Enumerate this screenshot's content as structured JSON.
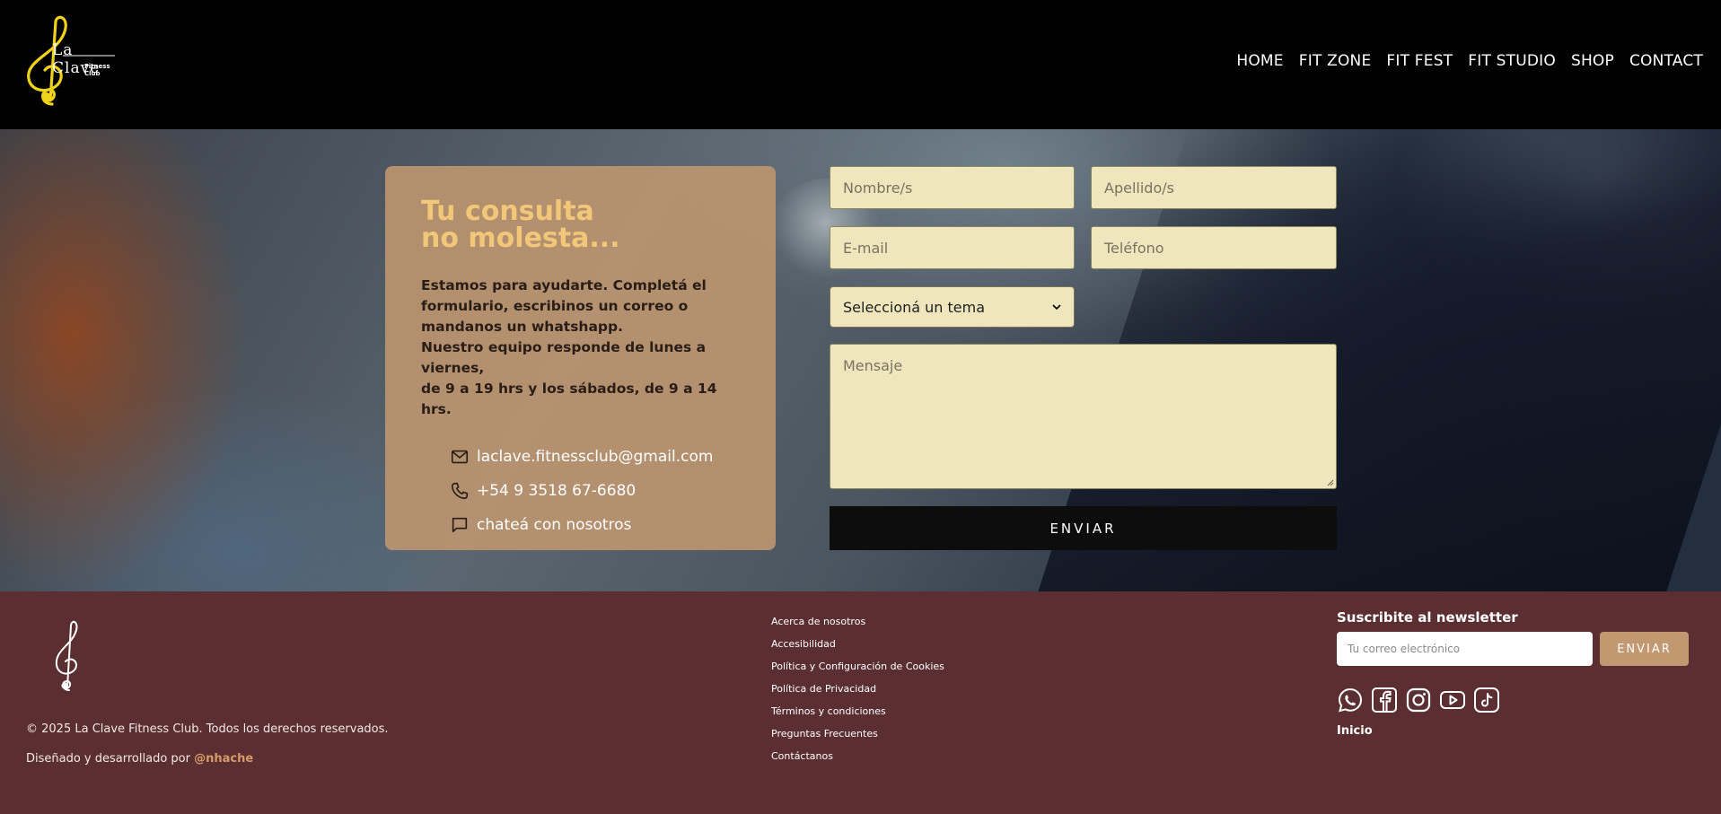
{
  "header": {
    "logo": {
      "main_text": "La Clave",
      "sub_text": "Fitness Club",
      "icon": "treble-clef-icon",
      "color": "#f0d319"
    },
    "nav": [
      "HOME",
      "FIT ZONE",
      "FIT FEST",
      "FIT STUDIO",
      "SHOP",
      "CONTACT"
    ]
  },
  "info_card": {
    "title_line1": "Tu consulta",
    "title_line2": "no molesta...",
    "body_line1": "Estamos para ayudarte. Completá el",
    "body_line2": "formulario, escribinos un correo o",
    "body_line3": "mandanos un whatshapp.",
    "body_line4": "Nuestro equipo responde de lunes a viernes,",
    "body_line5": "de 9 a 19 hrs y los sábados, de 9 a 14 hrs.",
    "contacts": [
      {
        "icon": "mail-icon",
        "text": "laclave.fitnessclub@gmail.com"
      },
      {
        "icon": "phone-icon",
        "text": "+54 9 3518 67-6680"
      },
      {
        "icon": "chat-icon",
        "text": "chateá con nosotros"
      }
    ],
    "bg_color": "#c29870",
    "title_color": "#f2c779"
  },
  "form": {
    "first_name_placeholder": "Nombre/s",
    "last_name_placeholder": "Apellido/s",
    "email_placeholder": "E-mail",
    "phone_placeholder": "Teléfono",
    "topic_selected": "Seleccioná un tema",
    "message_placeholder": "Mensaje",
    "submit_label": "ENVIAR",
    "field_color": "#efe6bd"
  },
  "footer": {
    "copyright": "© 2025 La Clave Fitness Club. Todos los derechos reservados.",
    "credit_prefix": "Diseñado y desarrollado por",
    "credit_link": "@nhache",
    "links": [
      "Acerca de nosotros",
      "Accesibilidad",
      "Política y Configuración de Cookies",
      "Política de Privacidad",
      "Términos y condiciones",
      "Preguntas Frecuentes",
      "Contáctanos"
    ],
    "newsletter": {
      "title": "Suscribite al newsletter",
      "placeholder": "Tu correo electrónico",
      "button": "ENVIAR"
    },
    "socials": [
      "whatsapp-icon",
      "facebook-icon",
      "instagram-icon",
      "youtube-icon",
      "tiktok-icon"
    ],
    "inicio": "Inicio",
    "bg_color": "#5b2f31",
    "accent_color": "#c29870"
  }
}
